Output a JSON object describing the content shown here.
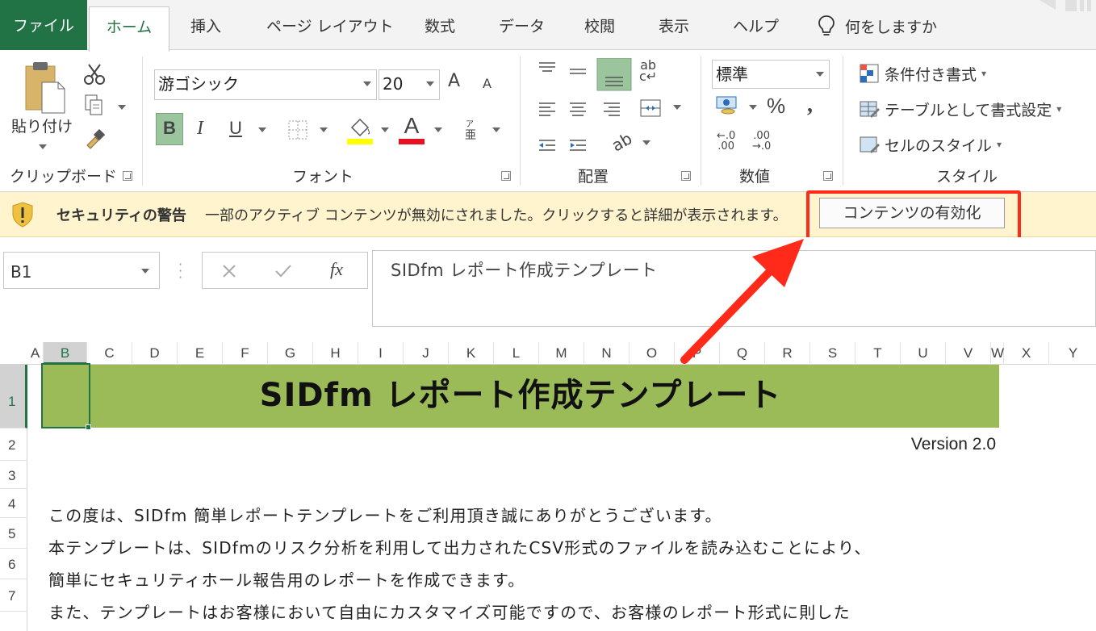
{
  "tabs": {
    "file": "ファイル",
    "home": "ホーム",
    "insert": "挿入",
    "page_layout": "ページ レイアウト",
    "formulas": "数式",
    "data": "データ",
    "review": "校閲",
    "view": "表示",
    "help": "ヘルプ",
    "tell_me": "何をしますか"
  },
  "ribbon": {
    "clipboard": {
      "paste": "貼り付け",
      "label": "クリップボード"
    },
    "font": {
      "name": "游ゴシック",
      "size": "20",
      "bold": "B",
      "italic": "I",
      "underline": "U",
      "grow": "A",
      "shrink": "A",
      "color_letter": "A",
      "label": "フォント"
    },
    "alignment": {
      "label": "配置"
    },
    "number": {
      "format": "標準",
      "percent": "%",
      "comma": ",",
      "label": "数値"
    },
    "styles": {
      "conditional": "条件付き書式",
      "as_table": "テーブルとして書式設定",
      "cell_styles": "セルのスタイル",
      "label": "スタイル"
    }
  },
  "security_bar": {
    "title": "セキュリティの警告",
    "message": "一部のアクティブ コンテンツが無効にされました。クリックすると詳細が表示されます。",
    "enable_button": "コンテンツの有効化"
  },
  "formula_bar": {
    "name_box": "B1",
    "formula": "SIDfm レポート作成テンプレート",
    "fx": "fx"
  },
  "columns": [
    "A",
    "B",
    "C",
    "D",
    "E",
    "F",
    "G",
    "H",
    "I",
    "J",
    "K",
    "L",
    "M",
    "N",
    "O",
    "P",
    "Q",
    "R",
    "S",
    "T",
    "U",
    "V",
    "W",
    "X",
    "Y"
  ],
  "rows": [
    "1",
    "2",
    "3",
    "4",
    "5",
    "6",
    "7"
  ],
  "sheet": {
    "title": "SIDfm レポート作成テンプレート",
    "version": "Version 2.0",
    "lines": [
      "この度は、SIDfm 簡単レポートテンプレートをご利用頂き誠にありがとうございます。",
      "本テンプレートは、SIDfmのリスク分析を利用して出力されたCSV形式のファイルを読み込むことにより、",
      "簡単にセキュリティホール報告用のレポートを作成できます。",
      "また、テンプレートはお客様において自由にカスタマイズ可能ですので、お客様のレポート形式に則した"
    ]
  },
  "colors": {
    "excel_green": "#217346",
    "title_band": "#9bbb59",
    "security_bar": "#fff4ce",
    "highlight_red": "#ff2a1a"
  }
}
